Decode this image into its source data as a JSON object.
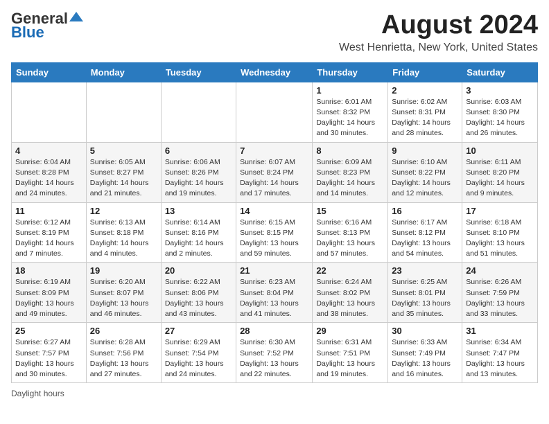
{
  "header": {
    "logo_general": "General",
    "logo_blue": "Blue",
    "month_title": "August 2024",
    "location": "West Henrietta, New York, United States"
  },
  "days_of_week": [
    "Sunday",
    "Monday",
    "Tuesday",
    "Wednesday",
    "Thursday",
    "Friday",
    "Saturday"
  ],
  "weeks": [
    [
      {
        "day": "",
        "sunrise": "",
        "sunset": "",
        "daylight": ""
      },
      {
        "day": "",
        "sunrise": "",
        "sunset": "",
        "daylight": ""
      },
      {
        "day": "",
        "sunrise": "",
        "sunset": "",
        "daylight": ""
      },
      {
        "day": "",
        "sunrise": "",
        "sunset": "",
        "daylight": ""
      },
      {
        "day": "1",
        "sunrise": "6:01 AM",
        "sunset": "8:32 PM",
        "daylight": "14 hours and 30 minutes."
      },
      {
        "day": "2",
        "sunrise": "6:02 AM",
        "sunset": "8:31 PM",
        "daylight": "14 hours and 28 minutes."
      },
      {
        "day": "3",
        "sunrise": "6:03 AM",
        "sunset": "8:30 PM",
        "daylight": "14 hours and 26 minutes."
      }
    ],
    [
      {
        "day": "4",
        "sunrise": "6:04 AM",
        "sunset": "8:28 PM",
        "daylight": "14 hours and 24 minutes."
      },
      {
        "day": "5",
        "sunrise": "6:05 AM",
        "sunset": "8:27 PM",
        "daylight": "14 hours and 21 minutes."
      },
      {
        "day": "6",
        "sunrise": "6:06 AM",
        "sunset": "8:26 PM",
        "daylight": "14 hours and 19 minutes."
      },
      {
        "day": "7",
        "sunrise": "6:07 AM",
        "sunset": "8:24 PM",
        "daylight": "14 hours and 17 minutes."
      },
      {
        "day": "8",
        "sunrise": "6:09 AM",
        "sunset": "8:23 PM",
        "daylight": "14 hours and 14 minutes."
      },
      {
        "day": "9",
        "sunrise": "6:10 AM",
        "sunset": "8:22 PM",
        "daylight": "14 hours and 12 minutes."
      },
      {
        "day": "10",
        "sunrise": "6:11 AM",
        "sunset": "8:20 PM",
        "daylight": "14 hours and 9 minutes."
      }
    ],
    [
      {
        "day": "11",
        "sunrise": "6:12 AM",
        "sunset": "8:19 PM",
        "daylight": "14 hours and 7 minutes."
      },
      {
        "day": "12",
        "sunrise": "6:13 AM",
        "sunset": "8:18 PM",
        "daylight": "14 hours and 4 minutes."
      },
      {
        "day": "13",
        "sunrise": "6:14 AM",
        "sunset": "8:16 PM",
        "daylight": "14 hours and 2 minutes."
      },
      {
        "day": "14",
        "sunrise": "6:15 AM",
        "sunset": "8:15 PM",
        "daylight": "13 hours and 59 minutes."
      },
      {
        "day": "15",
        "sunrise": "6:16 AM",
        "sunset": "8:13 PM",
        "daylight": "13 hours and 57 minutes."
      },
      {
        "day": "16",
        "sunrise": "6:17 AM",
        "sunset": "8:12 PM",
        "daylight": "13 hours and 54 minutes."
      },
      {
        "day": "17",
        "sunrise": "6:18 AM",
        "sunset": "8:10 PM",
        "daylight": "13 hours and 51 minutes."
      }
    ],
    [
      {
        "day": "18",
        "sunrise": "6:19 AM",
        "sunset": "8:09 PM",
        "daylight": "13 hours and 49 minutes."
      },
      {
        "day": "19",
        "sunrise": "6:20 AM",
        "sunset": "8:07 PM",
        "daylight": "13 hours and 46 minutes."
      },
      {
        "day": "20",
        "sunrise": "6:22 AM",
        "sunset": "8:06 PM",
        "daylight": "13 hours and 43 minutes."
      },
      {
        "day": "21",
        "sunrise": "6:23 AM",
        "sunset": "8:04 PM",
        "daylight": "13 hours and 41 minutes."
      },
      {
        "day": "22",
        "sunrise": "6:24 AM",
        "sunset": "8:02 PM",
        "daylight": "13 hours and 38 minutes."
      },
      {
        "day": "23",
        "sunrise": "6:25 AM",
        "sunset": "8:01 PM",
        "daylight": "13 hours and 35 minutes."
      },
      {
        "day": "24",
        "sunrise": "6:26 AM",
        "sunset": "7:59 PM",
        "daylight": "13 hours and 33 minutes."
      }
    ],
    [
      {
        "day": "25",
        "sunrise": "6:27 AM",
        "sunset": "7:57 PM",
        "daylight": "13 hours and 30 minutes."
      },
      {
        "day": "26",
        "sunrise": "6:28 AM",
        "sunset": "7:56 PM",
        "daylight": "13 hours and 27 minutes."
      },
      {
        "day": "27",
        "sunrise": "6:29 AM",
        "sunset": "7:54 PM",
        "daylight": "13 hours and 24 minutes."
      },
      {
        "day": "28",
        "sunrise": "6:30 AM",
        "sunset": "7:52 PM",
        "daylight": "13 hours and 22 minutes."
      },
      {
        "day": "29",
        "sunrise": "6:31 AM",
        "sunset": "7:51 PM",
        "daylight": "13 hours and 19 minutes."
      },
      {
        "day": "30",
        "sunrise": "6:33 AM",
        "sunset": "7:49 PM",
        "daylight": "13 hours and 16 minutes."
      },
      {
        "day": "31",
        "sunrise": "6:34 AM",
        "sunset": "7:47 PM",
        "daylight": "13 hours and 13 minutes."
      }
    ]
  ],
  "footer": {
    "note": "Daylight hours"
  }
}
